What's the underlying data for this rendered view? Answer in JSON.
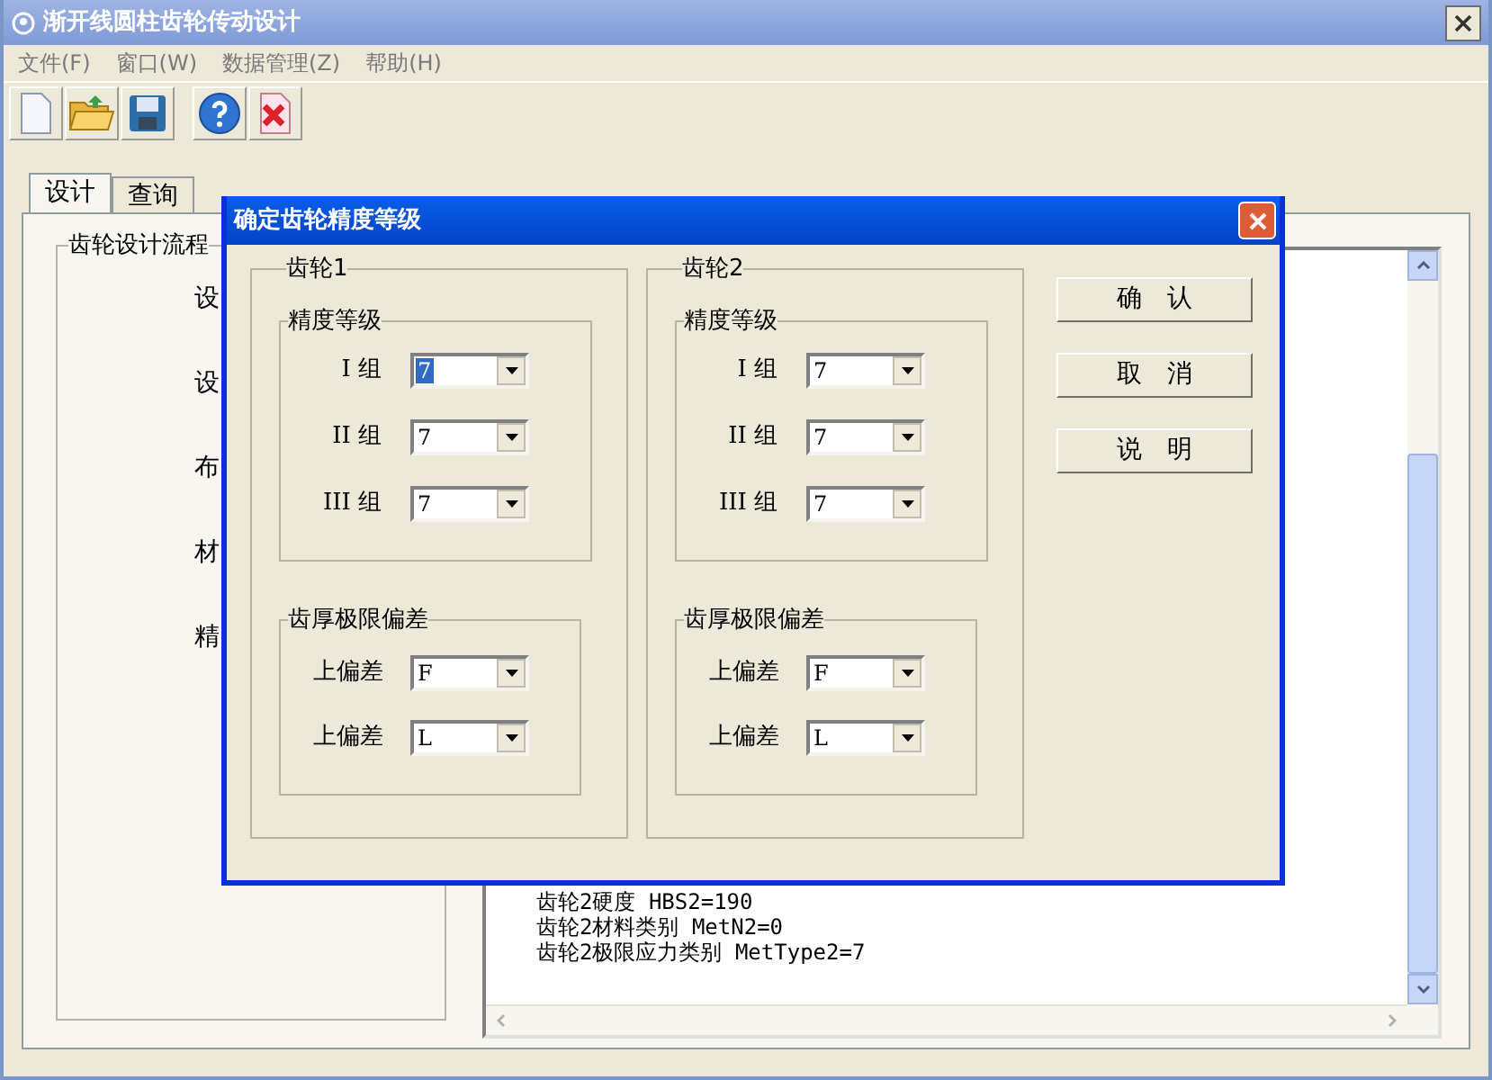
{
  "window": {
    "title": "渐开线圆柱齿轮传动设计"
  },
  "menu": [
    "文件(F)",
    "窗口(W)",
    "数据管理(Z)",
    "帮助(H)"
  ],
  "tabs": [
    {
      "label": "设计",
      "selected": true
    },
    {
      "label": "查询",
      "selected": false
    }
  ],
  "flow_panel": {
    "title": "齿轮设计流程",
    "items": [
      "设",
      "设",
      "布",
      "材",
      "精"
    ]
  },
  "output": {
    "lines": [
      "齿轮2硬度 HBS2=190",
      "齿轮2材料类别 MetN2=0",
      "齿轮2极限应力类别 MetType2=7"
    ]
  },
  "dialog": {
    "title": "确定齿轮精度等级",
    "gears": [
      {
        "title": "齿轮1",
        "accuracy": {
          "title": "精度等级",
          "rows": [
            {
              "label": "I 组",
              "value": "7",
              "highlighted": true
            },
            {
              "label": "II 组",
              "value": "7",
              "highlighted": false
            },
            {
              "label": "III 组",
              "value": "7",
              "highlighted": false
            }
          ]
        },
        "deviation": {
          "title": "齿厚极限偏差",
          "rows": [
            {
              "label": "上偏差",
              "value": "F",
              "highlighted": false
            },
            {
              "label": "上偏差",
              "value": "L",
              "highlighted": false
            }
          ]
        }
      },
      {
        "title": "齿轮2",
        "accuracy": {
          "title": "精度等级",
          "rows": [
            {
              "label": "I 组",
              "value": "7",
              "highlighted": false
            },
            {
              "label": "II 组",
              "value": "7",
              "highlighted": false
            },
            {
              "label": "III 组",
              "value": "7",
              "highlighted": false
            }
          ]
        },
        "deviation": {
          "title": "齿厚极限偏差",
          "rows": [
            {
              "label": "上偏差",
              "value": "F",
              "highlighted": false
            },
            {
              "label": "上偏差",
              "value": "L",
              "highlighted": false
            }
          ]
        }
      }
    ],
    "buttons": [
      "确　认",
      "取　消",
      "说　明"
    ]
  }
}
